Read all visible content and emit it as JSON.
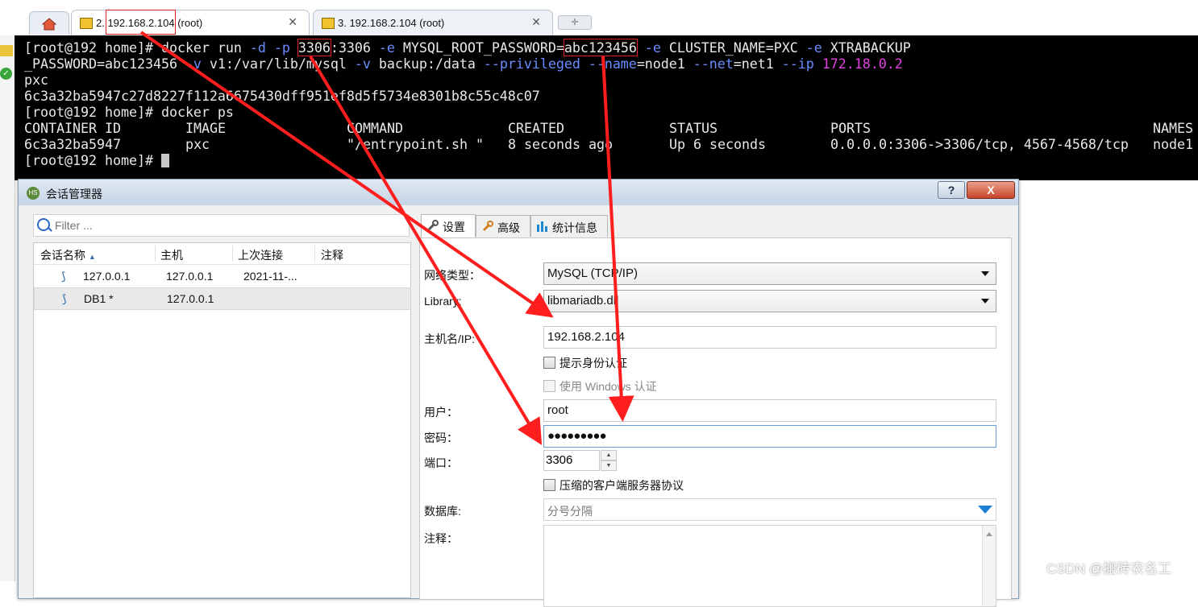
{
  "tabs": [
    {
      "label": "2. 192.168.2.104 (root)"
    },
    {
      "label": "3. 192.168.2.104 (root)"
    }
  ],
  "terminal": {
    "prompt": "[root@192 home]#",
    "line1_cmd": " docker run ",
    "line1_d": "-d",
    "line1_p": "-p",
    "line1_port": "3306",
    "line1_port2": ":3306 ",
    "line1_e": "-e",
    "line1_env1": " MYSQL_ROOT_PASSWORD=",
    "line1_pwd": "abc123456",
    "line1_e2": " -e",
    "line1_env2": " CLUSTER_NAME=PXC ",
    "line1_e3": "-e",
    "line1_env3": " XTRABACKUP",
    "line2_env": "_PASSWORD=abc123456 ",
    "line2_v1": "-v",
    "line2_vol1": " v1:/var/lib/mysql ",
    "line2_v2": "-v",
    "line2_vol2": " backup:/data ",
    "line2_priv": "--privileged",
    "line2_name": " --name",
    "line2_nameval": "=node1 ",
    "line2_net": "--net",
    "line2_netval": "=net1 ",
    "line2_ip": "--ip",
    "line2_ipval": "172.18.0.2",
    "line3": "pxc",
    "line4": "6c3a32ba5947c27d8227f112a6675430dff951ef8d5f5734e8301b8c55c48c07",
    "line5_cmd": " docker ps",
    "ps_headers": [
      "CONTAINER ID",
      "IMAGE",
      "COMMAND",
      "CREATED",
      "STATUS",
      "PORTS",
      "NAMES"
    ],
    "ps_row": [
      "6c3a32ba5947",
      "pxc",
      "\"/entrypoint.sh \"",
      "8 seconds ago",
      "Up 6 seconds",
      "0.0.0.0:3306->3306/tcp, 4567-4568/tcp",
      "node1"
    ]
  },
  "dialog": {
    "title": "会话管理器",
    "help_label": "?",
    "close_label": "X",
    "filter_placeholder": "Filter ...",
    "columns": [
      "会话名称",
      "主机",
      "上次连接",
      "注释"
    ],
    "sessions": [
      {
        "name": "127.0.0.1",
        "host": "127.0.0.1",
        "last": "2021-11-...",
        "note": ""
      },
      {
        "name": "DB1 *",
        "host": "127.0.0.1",
        "last": "",
        "note": ""
      }
    ],
    "tabs": [
      "设置",
      "高级",
      "统计信息"
    ],
    "fields": {
      "network_type_label": "网络类型：",
      "network_type_value": "MySQL (TCP/IP)",
      "library_label": "Library:",
      "library_value": "libmariadb.dll",
      "host_label": "主机名/IP:",
      "host_value": "192.168.2.104",
      "prompt_auth_label": "提示身份认证",
      "windows_auth_label": "使用 Windows 认证",
      "user_label": "用户：",
      "user_value": "root",
      "password_label": "密码：",
      "password_value": "●●●●●●●●●",
      "port_label": "端口：",
      "port_value": "3306",
      "compress_label": "压缩的客户端服务器协议",
      "database_label": "数据库:",
      "database_placeholder": "分号分隔",
      "notes_label": "注释："
    }
  },
  "watermark": "CSDN @搬砖农名工",
  "colors": {
    "annotation_red": "#ff1e1e",
    "terminal_bg": "#000000",
    "dialog_bg": "#f0f0f0"
  }
}
